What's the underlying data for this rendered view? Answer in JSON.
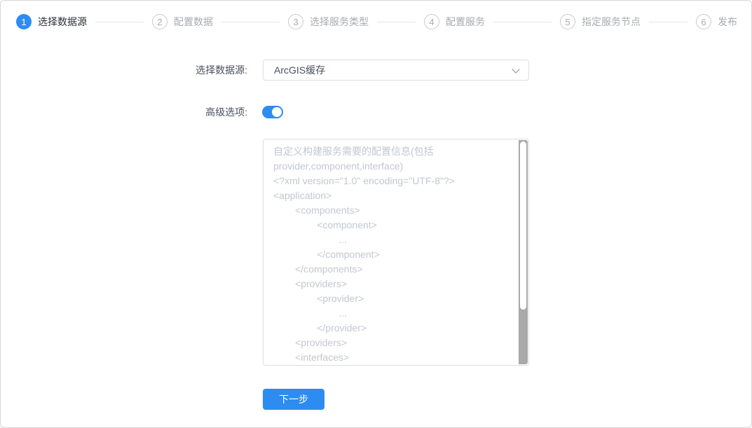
{
  "wizard": {
    "steps": [
      {
        "number": "1",
        "label": "选择数据源",
        "state": "active"
      },
      {
        "number": "2",
        "label": "配置数据",
        "state": "wait"
      },
      {
        "number": "3",
        "label": "选择服务类型",
        "state": "wait"
      },
      {
        "number": "4",
        "label": "配置服务",
        "state": "wait"
      },
      {
        "number": "5",
        "label": "指定服务节点",
        "state": "wait"
      },
      {
        "number": "6",
        "label": "发布",
        "state": "wait"
      }
    ]
  },
  "form": {
    "datasource_label": "选择数据源:",
    "datasource_value": "ArcGIS缓存",
    "advanced_label": "高级选项:",
    "advanced_toggle_state": "on",
    "config_placeholder": "自定义构建服务需要的配置信息(包括\nprovider,component,interface)\n<?xml version=\"1.0\" encoding=\"UTF-8\"?>\n<application>\n        <components>\n                <component>\n                        ...\n                </component>\n        </components>\n        <providers>\n                <provider>\n                        ...\n                </provider>\n        <providers>\n        <interfaces>"
  },
  "actions": {
    "next_label": "下一步"
  },
  "colors": {
    "accent": "#2d8cf0",
    "step-wait-border": "#c8c9cc",
    "step-wait-text": "#a8abb0",
    "connector": "#e3e5e8",
    "field-border": "#dcdee2",
    "placeholder": "#c3c7cf",
    "label-text": "#495060",
    "scroll-track": "#a9a9a9",
    "page-border": "#d6d6d6",
    "step-active-text": "#2b2f36"
  }
}
